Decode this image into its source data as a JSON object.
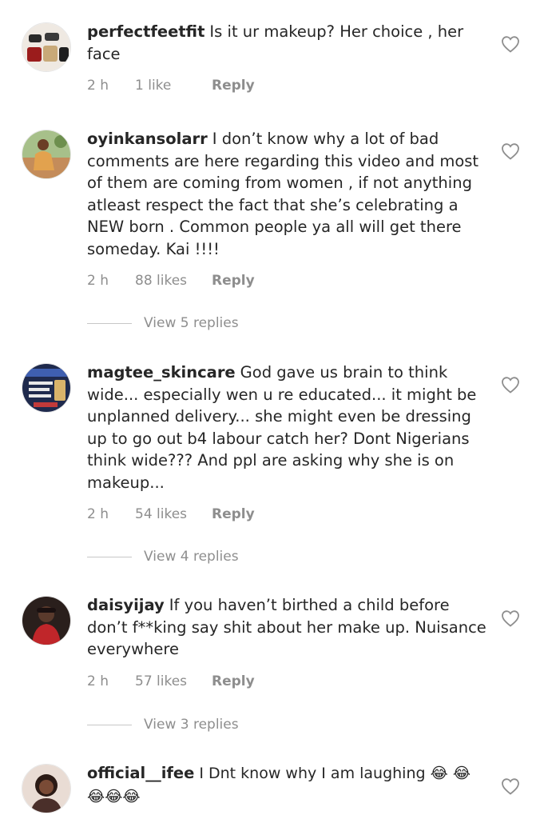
{
  "comments": [
    {
      "username": "perfectfeetfit",
      "text": "Is it ur makeup? Her choice , her face",
      "time": "2 h",
      "likes": "1 like",
      "reply": "Reply"
    },
    {
      "username": "oyinkansolarr",
      "text": "I don’t know why a lot of bad comments are here regarding this video and most of them are coming from women , if not anything atleast respect the fact that she’s celebrating a NEW born . Common people ya all will get there someday. Kai !!!!",
      "time": "2 h",
      "likes": "88 likes",
      "reply": "Reply",
      "view_replies": "View 5 replies"
    },
    {
      "username": "magtee_skincare",
      "text": "God gave us brain to think wide... especially wen u re educated... it might be unplanned delivery... she might even be dressing up to go out b4 labour catch her? Dont Nigerians think wide??? And ppl are asking why she is on makeup...",
      "time": "2 h",
      "likes": "54 likes",
      "reply": "Reply",
      "view_replies": "View 4 replies"
    },
    {
      "username": "daisyijay",
      "text": "If you haven’t birthed a child before don’t f**king say shit about her make up. Nuisance everywhere",
      "time": "2 h",
      "likes": "57 likes",
      "reply": "Reply",
      "view_replies": "View 3 replies"
    },
    {
      "username": "official__ifee",
      "text": "I Dnt know why I am laughing 😂 😂😂😂😂"
    }
  ],
  "icons": {
    "heart": "heart-outline-icon",
    "avatar_colors": [
      "#5a4a3c",
      "#c98a5a",
      "#2d3a5c",
      "#3a2420",
      "#4a2f2a"
    ]
  }
}
